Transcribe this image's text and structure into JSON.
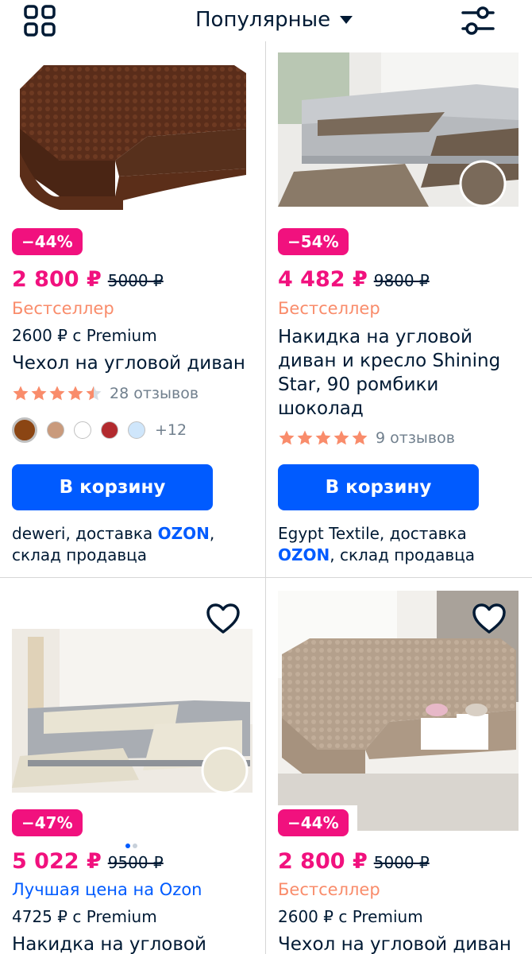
{
  "header": {
    "sort_label": "Популярные"
  },
  "colors": {
    "accent": "#005bff",
    "sale": "#f1117e",
    "bestseller": "#f98c6b",
    "star": "#f98c6b",
    "star_empty": "#d7dde3"
  },
  "cart_label": "В корзину",
  "products": [
    {
      "discount": "−44%",
      "price": "2 800 ₽",
      "old_price": "5000 ₽",
      "label": "Бестселлер",
      "premium": "2600 ₽ с Premium",
      "title": "Чехол на угловой диван",
      "rating_value": 4.5,
      "reviews": "28 отзывов",
      "swatches": [
        "#8b4513",
        "#c99a7c",
        "#ffffff",
        "#b22a2e",
        "#cfe6fb"
      ],
      "swatch_more": "+12",
      "seller_name": "deweri, доставка ",
      "seller_ozon": "OZON",
      "seller_rest": ", склад продавца"
    },
    {
      "discount": "−54%",
      "price": "4 482 ₽",
      "old_price": "9800 ₽",
      "label": "Бестселлер",
      "title": "Накидка на угловой диван и кресло Shining Star, 90 ромбики шоколад",
      "rating_value": 5,
      "reviews": "9 отзывов",
      "seller_name": "Egypt Textile, доставка ",
      "seller_ozon": "OZON",
      "seller_rest": ", склад продавца"
    },
    {
      "discount": "−47%",
      "price": "5 022 ₽",
      "old_price": "9500 ₽",
      "label": "Лучшая цена на Ozon",
      "premium": "4725 ₽ с Premium",
      "title": "Накидка на угловой"
    },
    {
      "discount": "−44%",
      "price": "2 800 ₽",
      "old_price": "5000 ₽",
      "label": "Бестселлер",
      "premium": "2600 ₽ с Premium",
      "title": "Чехол на угловой диван"
    }
  ]
}
